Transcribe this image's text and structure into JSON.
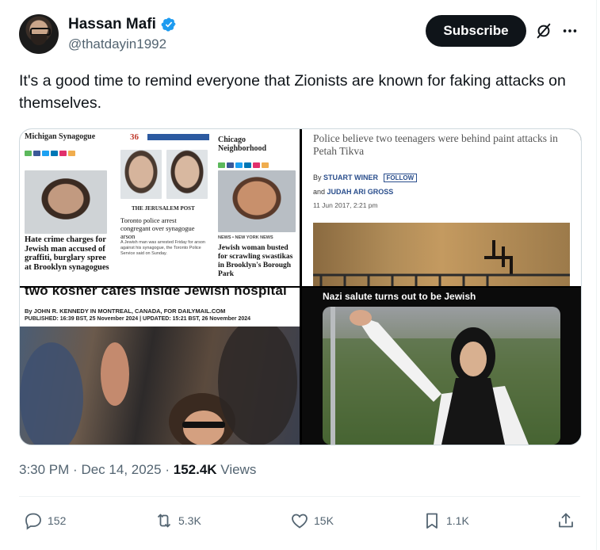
{
  "author": {
    "name": "Hassan Mafi",
    "handle": "@thatdayin1992"
  },
  "header": {
    "subscribe_label": "Subscribe"
  },
  "tweet": {
    "text": "It's a good time to remind everyone that Zionists are known for faking attacks on themselves."
  },
  "media": {
    "tile1": {
      "col1_head": "Michigan Synagogue",
      "col1_caption": "Hate crime charges for Jewish man accused of graffiti, burglary spree at Brooklyn synagogues",
      "col2_number": "36",
      "col2_logo": "THE JERUSALEM POST",
      "col2_caption": "Toronto police arrest congregant over synagogue arson",
      "col2_body": "A Jewish man was arrested Friday for arson against his synagogue, the Toronto Police Service said on Sunday.",
      "col3_head": "Chicago Neighborhood",
      "col3_kicker": "NEWS • NEW YORK NEWS",
      "col3_caption": "Jewish woman busted for scrawling swastikas in Brooklyn's Borough Park"
    },
    "tile2": {
      "headline": "Police believe two teenagers were behind paint attacks in Petah Tikva",
      "by_prefix": "By",
      "author1": "STUART WINER",
      "follow_label": "FOLLOW",
      "and_prefix": "and",
      "author2": "JUDAH ARI GROSS",
      "date": "11 Jun 2017, 2:21 pm"
    },
    "tile3": {
      "headline": "two kosher cafes inside Jewish hospital",
      "byline": "By JOHN R. KENNEDY IN MONTREAL, CANADA, FOR DAILYMAIL.COM",
      "published": "PUBLISHED: 16:39 BST, 25 November 2024 | UPDATED: 15:21 BST, 26 November 2024"
    },
    "tile4": {
      "caption": "Nazi salute turns out to be Jewish"
    }
  },
  "meta": {
    "time": "3:30 PM",
    "sep1": "·",
    "date": "Dec 14, 2025",
    "sep2": "·",
    "views_count": "152.4K",
    "views_label": "Views"
  },
  "actions": {
    "replies": "152",
    "reposts": "5.3K",
    "likes": "15K",
    "bookmarks": "1.1K"
  },
  "icons": {
    "verified": "verified-badge-icon",
    "grok": "grok-icon",
    "more": "more-icon",
    "reply": "reply-icon",
    "repost": "repost-icon",
    "like": "heart-icon",
    "bookmark": "bookmark-icon",
    "share": "share-icon"
  },
  "colors": {
    "verified_blue": "#1d9bf0",
    "text_primary": "#0f1419",
    "text_secondary": "#536471"
  }
}
